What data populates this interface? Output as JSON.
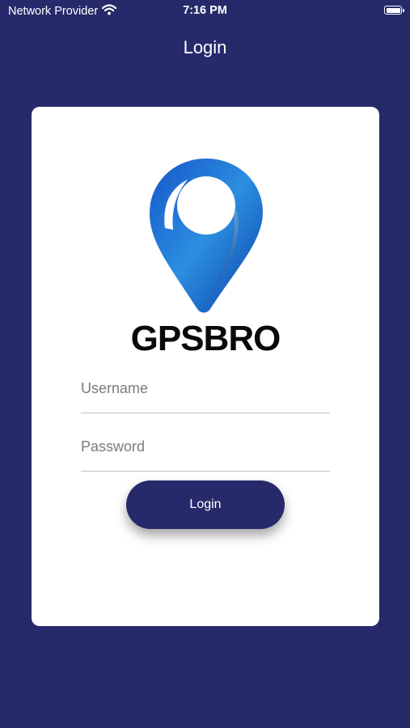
{
  "status_bar": {
    "carrier": "Network Provider",
    "time": "7:16 PM"
  },
  "nav": {
    "title": "Login"
  },
  "logo": {
    "brand_text": "GPSBRO",
    "icon": "map-pin-icon"
  },
  "form": {
    "username_placeholder": "Username",
    "username_value": "",
    "password_placeholder": "Password",
    "password_value": "",
    "login_label": "Login"
  },
  "colors": {
    "background": "#262a6a",
    "card": "#ffffff",
    "button": "#262a6a",
    "field_underline": "#bfbfbf",
    "logo_blue": "#1e6fd9"
  }
}
